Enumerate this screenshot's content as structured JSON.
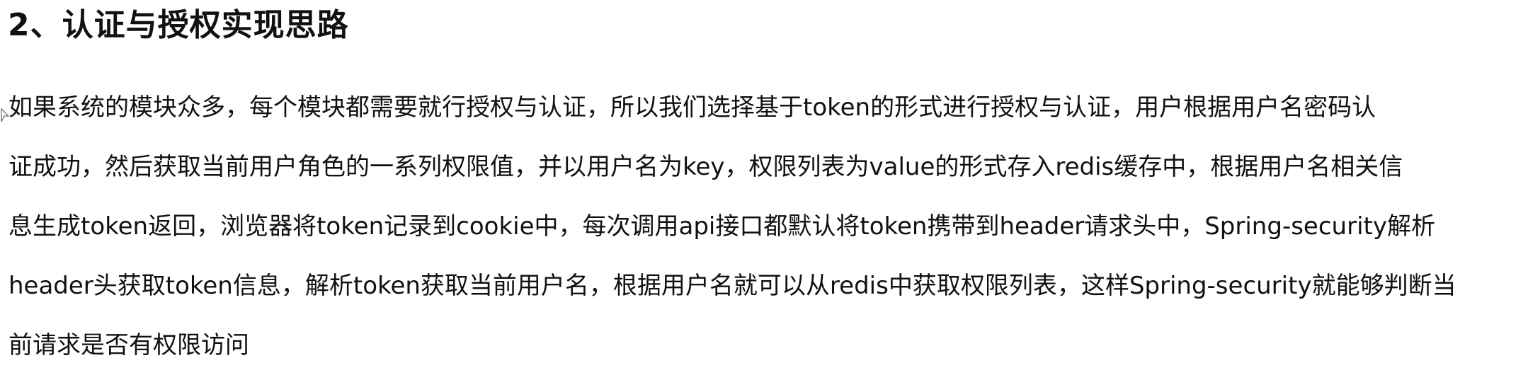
{
  "heading": "2、认证与授权实现思路",
  "paragraph_lines": [
    "如果系统的模块众多，每个模块都需要就行授权与认证，所以我们选择基于token的形式进行授权与认证，用户根据用户名密码认",
    "证成功，然后获取当前用户角色的一系列权限值，并以用户名为key，权限列表为value的形式存入redis缓存中，根据用户名相关信",
    "息生成token返回，浏览器将token记录到cookie中，每次调用api接口都默认将token携带到header请求头中，Spring-security解析",
    "header头获取token信息，解析token获取当前用户名，根据用户名就可以从redis中获取权限列表，这样Spring-security就能够判断当",
    "前请求是否有权限访问"
  ]
}
